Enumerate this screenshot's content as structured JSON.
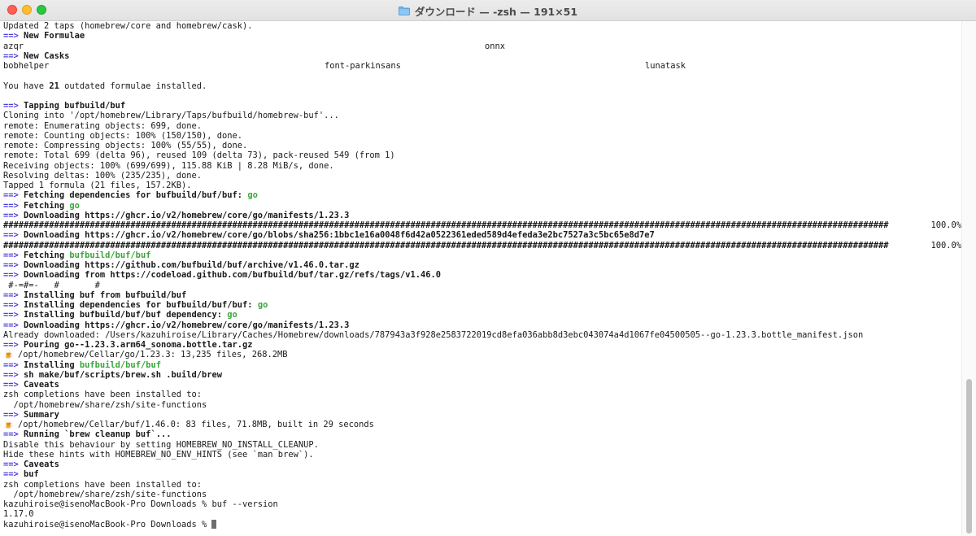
{
  "window": {
    "title": "ダウンロード — -zsh — 191×51",
    "colors": {
      "prompt_arrow": "#4b3ee0",
      "highlight_green": "#3aa63a"
    }
  },
  "terminal": {
    "lines": [
      "Updated 2 taps (homebrew/core and homebrew/cask).",
      "==>",
      "New Formulae",
      "azqr",
      "onnx",
      "==>",
      "New Casks",
      "bobhelper",
      "font-parkinsans",
      "lunatask",
      "You have ",
      "21",
      " outdated formulae installed.",
      "==>",
      "Tapping bufbuild/buf",
      "Cloning into '/opt/homebrew/Library/Taps/bufbuild/homebrew-buf'...",
      "remote: Enumerating objects: 699, done.",
      "remote: Counting objects: 100% (150/150), done.",
      "remote: Compressing objects: 100% (55/55), done.",
      "remote: Total 699 (delta 96), reused 109 (delta 73), pack-reused 549 (from 1)",
      "Receiving objects: 100% (699/699), 115.88 KiB | 8.28 MiB/s, done.",
      "Resolving deltas: 100% (235/235), done.",
      "Tapped 1 formula (21 files, 157.2KB).",
      "==>",
      "Fetching dependencies for bufbuild/buf/buf: ",
      "go",
      "==>",
      "Fetching ",
      "go",
      "==>",
      "Downloading https://ghcr.io/v2/homebrew/core/go/manifests/1.23.3",
      "##############################################################################################################################################################################",
      "100.0%",
      "==>",
      "Downloading https://ghcr.io/v2/homebrew/core/go/blobs/sha256:1bbc1e16a0048f6d42a0522361eded589d4efeda3e2bc7527a3c5bc65e8d7e7",
      "##############################################################################################################################################################################",
      "100.0%",
      "==>",
      "Fetching ",
      "bufbuild/buf/buf",
      "==>",
      "Downloading https://github.com/bufbuild/buf/archive/v1.46.0.tar.gz",
      "==>",
      "Downloading from https://codeload.github.com/bufbuild/buf/tar.gz/refs/tags/v1.46.0",
      " #-=#=-   #       #",
      "==>",
      "Installing buf from bufbuild/buf",
      "==>",
      "Installing dependencies for bufbuild/buf/buf: ",
      "go",
      "==>",
      "Installing bufbuild/buf/buf dependency: ",
      "go",
      "==>",
      "Downloading https://ghcr.io/v2/homebrew/core/go/manifests/1.23.3",
      "Already downloaded: /Users/kazuhiroise/Library/Caches/Homebrew/downloads/787943a3f928e2583722019cd8efa036abb8d3ebc043074a4d1067fe04500505--go-1.23.3.bottle_manifest.json",
      "==>",
      "Pouring go--1.23.3.arm64_sonoma.bottle.tar.gz",
      "🍺",
      "/opt/homebrew/Cellar/go/1.23.3: 13,235 files, 268.2MB",
      "==>",
      "Installing ",
      "bufbuild/buf/buf",
      "==>",
      "sh make/buf/scripts/brew.sh .build/brew",
      "==>",
      "Caveats",
      "zsh completions have been installed to:",
      "  /opt/homebrew/share/zsh/site-functions",
      "==>",
      "Summary",
      "🍺",
      "/opt/homebrew/Cellar/buf/1.46.0: 83 files, 71.8MB, built in 29 seconds",
      "==>",
      "Running `brew cleanup buf`...",
      "Disable this behaviour by setting HOMEBREW_NO_INSTALL_CLEANUP.",
      "Hide these hints with HOMEBREW_NO_ENV_HINTS (see `man brew`).",
      "==>",
      "Caveats",
      "==>",
      "buf",
      "zsh completions have been installed to:",
      "  /opt/homebrew/share/zsh/site-functions",
      "kazuhiroise@isenoMacBook-Pro Downloads % buf --version",
      "1.17.0",
      "kazuhiroise@isenoMacBook-Pro Downloads % "
    ]
  }
}
